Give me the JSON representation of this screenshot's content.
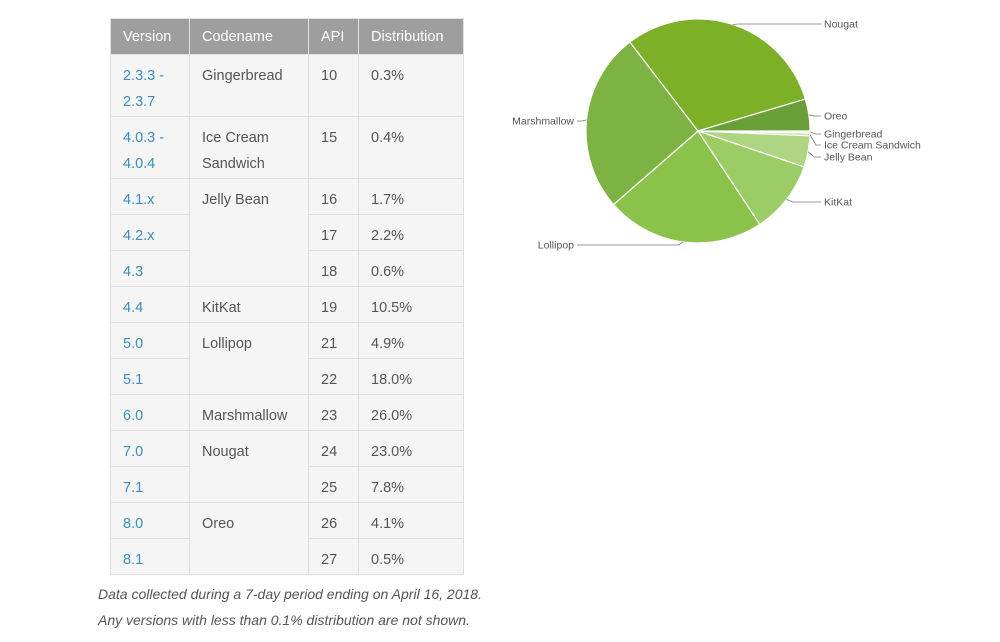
{
  "table": {
    "headers": [
      "Version",
      "Codename",
      "API",
      "Distribution"
    ],
    "rows": [
      {
        "version": "2.3.3 - 2.3.7",
        "codename": "Gingerbread",
        "api": "10",
        "distribution": "0.3%"
      },
      {
        "version": "4.0.3 - 4.0.4",
        "codename": "Ice Cream Sandwich",
        "api": "15",
        "distribution": "0.4%"
      },
      {
        "version": "4.1.x",
        "codename": "Jelly Bean",
        "api": "16",
        "distribution": "1.7%"
      },
      {
        "version": "4.2.x",
        "codename": "",
        "api": "17",
        "distribution": "2.2%"
      },
      {
        "version": "4.3",
        "codename": "",
        "api": "18",
        "distribution": "0.6%"
      },
      {
        "version": "4.4",
        "codename": "KitKat",
        "api": "19",
        "distribution": "10.5%"
      },
      {
        "version": "5.0",
        "codename": "Lollipop",
        "api": "21",
        "distribution": "4.9%"
      },
      {
        "version": "5.1",
        "codename": "",
        "api": "22",
        "distribution": "18.0%"
      },
      {
        "version": "6.0",
        "codename": "Marshmallow",
        "api": "23",
        "distribution": "26.0%"
      },
      {
        "version": "7.0",
        "codename": "Nougat",
        "api": "24",
        "distribution": "23.0%"
      },
      {
        "version": "7.1",
        "codename": "",
        "api": "25",
        "distribution": "7.8%"
      },
      {
        "version": "8.0",
        "codename": "Oreo",
        "api": "26",
        "distribution": "4.1%"
      },
      {
        "version": "8.1",
        "codename": "",
        "api": "27",
        "distribution": "0.5%"
      }
    ]
  },
  "notes": {
    "line1": "Data collected during a 7-day period ending on April 16, 2018.",
    "line2": "Any versions with less than 0.1% distribution are not shown."
  },
  "chart_data": {
    "type": "pie",
    "title": "",
    "legend": "labels-on-slices",
    "slices": [
      {
        "label": "Gingerbread",
        "value": 0.3,
        "color": "#dcedc8"
      },
      {
        "label": "Ice Cream Sandwich",
        "value": 0.4,
        "color": "#c5e1a5"
      },
      {
        "label": "Jelly Bean",
        "value": 4.5,
        "color": "#aed581"
      },
      {
        "label": "KitKat",
        "value": 10.5,
        "color": "#9ccc65"
      },
      {
        "label": "Lollipop",
        "value": 22.9,
        "color": "#8bc34a"
      },
      {
        "label": "Marshmallow",
        "value": 26.0,
        "color": "#7cb342"
      },
      {
        "label": "Nougat",
        "value": 30.8,
        "color": "#7bb027"
      },
      {
        "label": "Oreo",
        "value": 4.6,
        "color": "#689f38"
      }
    ]
  }
}
